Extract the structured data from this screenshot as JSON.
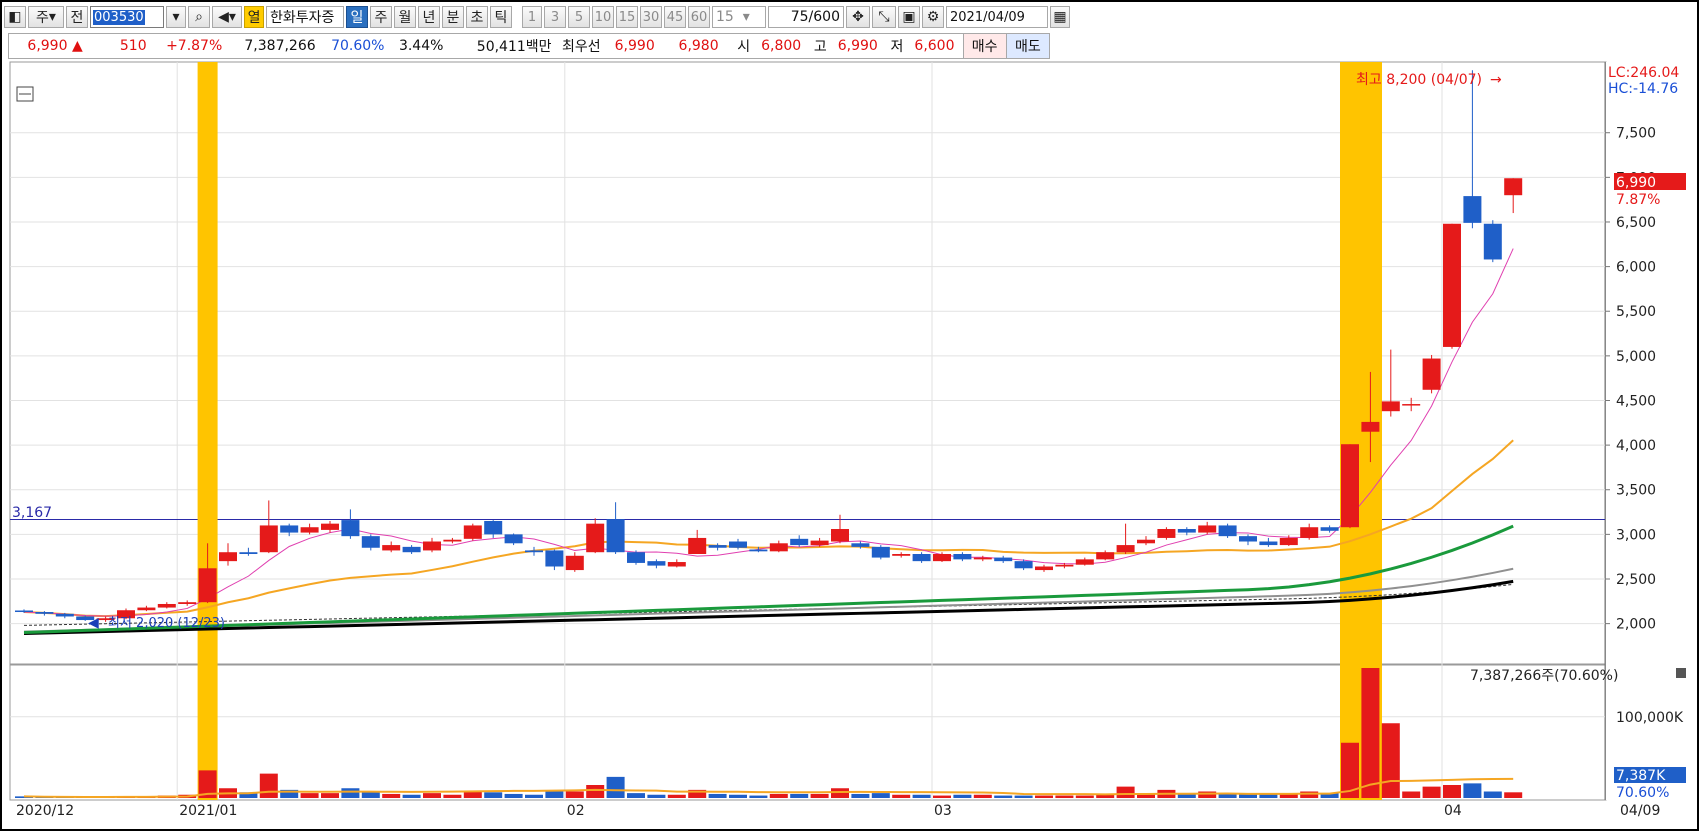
{
  "toolbar": {
    "market_label": "주",
    "prev_label": "전",
    "stock_code": "003530",
    "open_label": "열",
    "stock_name": "한화투자증",
    "periods": [
      "일",
      "주",
      "월",
      "년",
      "분",
      "초",
      "틱"
    ],
    "selected_period": "일",
    "intervals": [
      "1",
      "3",
      "5",
      "10",
      "15",
      "30",
      "45",
      "60"
    ],
    "interval_value": "15",
    "count_value": "75",
    "count_total": "/600",
    "date_value": "2021/04/09"
  },
  "quote": {
    "price": "6,990",
    "change": "510",
    "change_pct": "+7.87%",
    "volume": "7,387,266",
    "volume_ratio": "70.60%",
    "turnover": "3.44%",
    "amount": "50,411백만",
    "best_quote_label": "최우선",
    "ask": "6,990",
    "bid": "6,980",
    "open_label": "시",
    "open": "6,800",
    "high_label": "고",
    "high": "6,990",
    "low_label": "저",
    "low": "6,600",
    "buy_label": "매수",
    "sell_label": "매도"
  },
  "chart_labels": {
    "lc": "LC:246.04",
    "hc": "HC:-14.76",
    "high_marker": "최고 8,200 (04/07)",
    "low_marker": "최저 2,020 (12/23)",
    "hline_value": "3,167",
    "price_tag": "6,990",
    "pct_tag": "7.87%",
    "volume_header": "7,387,266주(70.60%)",
    "vol_tag": "7,387K",
    "vol_pct_tag": "70.60%"
  },
  "colors": {
    "up": "#e51a1a",
    "down": "#1f5fc8",
    "highlight": "#ffc400",
    "ma5": "#e040b0",
    "ma20": "#f5a623",
    "ma60": "#1a9a3c",
    "ma120": "#000000",
    "ma240": "#909090"
  },
  "chart_data": {
    "type": "candlestick",
    "x_labels": [
      "2020/12",
      "2021/01",
      "02",
      "03",
      "04",
      "04/09"
    ],
    "price_axis": [
      "7,500",
      "7,000",
      "6,500",
      "6,000",
      "5,500",
      "5,000",
      "4,500",
      "4,000",
      "3,500",
      "3,000",
      "2,500",
      "2,000"
    ],
    "ylim": [
      1570,
      8270
    ],
    "volume_axis": [
      "100,000K"
    ],
    "hline": 3167,
    "candles": [
      [
        2147,
        2130,
        2160,
        2120,
        2
      ],
      [
        2130,
        2110,
        2140,
        2090,
        1
      ],
      [
        2110,
        2080,
        2120,
        2060,
        1
      ],
      [
        2080,
        2040,
        2090,
        2030,
        1
      ],
      [
        2040,
        2060,
        2080,
        2020,
        1
      ],
      [
        2060,
        2150,
        2170,
        2050,
        2
      ],
      [
        2150,
        2180,
        2200,
        2140,
        2
      ],
      [
        2180,
        2220,
        2240,
        2170,
        3
      ],
      [
        2220,
        2240,
        2260,
        2200,
        4
      ],
      [
        2240,
        2620,
        2900,
        2230,
        34
      ],
      [
        2700,
        2800,
        2900,
        2650,
        12
      ],
      [
        2800,
        2780,
        2850,
        2760,
        7
      ],
      [
        2800,
        3100,
        3380,
        2790,
        30
      ],
      [
        3100,
        3020,
        3120,
        2980,
        10
      ],
      [
        3020,
        3080,
        3120,
        3000,
        6
      ],
      [
        3050,
        3120,
        3150,
        3020,
        6
      ],
      [
        3160,
        2980,
        3280,
        2950,
        12
      ],
      [
        2980,
        2850,
        3000,
        2820,
        7
      ],
      [
        2820,
        2880,
        2920,
        2800,
        5
      ],
      [
        2860,
        2800,
        2880,
        2780,
        4
      ],
      [
        2820,
        2920,
        2960,
        2800,
        6
      ],
      [
        2920,
        2940,
        2960,
        2900,
        4
      ],
      [
        2950,
        3100,
        3120,
        2930,
        8
      ],
      [
        3150,
        3000,
        3160,
        2960,
        7
      ],
      [
        3000,
        2900,
        3010,
        2880,
        5
      ],
      [
        2820,
        2800,
        2860,
        2760,
        4
      ],
      [
        2820,
        2640,
        2830,
        2600,
        8
      ],
      [
        2600,
        2760,
        2800,
        2580,
        8
      ],
      [
        2800,
        3120,
        3180,
        2790,
        16
      ],
      [
        3170,
        2800,
        3360,
        2780,
        26
      ],
      [
        2800,
        2680,
        2820,
        2660,
        6
      ],
      [
        2700,
        2650,
        2720,
        2620,
        4
      ],
      [
        2640,
        2690,
        2720,
        2630,
        4
      ],
      [
        2780,
        2960,
        3050,
        2780,
        10
      ],
      [
        2880,
        2850,
        2900,
        2820,
        5
      ],
      [
        2920,
        2850,
        2950,
        2830,
        4
      ],
      [
        2830,
        2810,
        2860,
        2800,
        3
      ],
      [
        2810,
        2900,
        2930,
        2800,
        5
      ],
      [
        2950,
        2880,
        2990,
        2860,
        5
      ],
      [
        2880,
        2930,
        2960,
        2860,
        5
      ],
      [
        2920,
        3060,
        3220,
        2900,
        12
      ],
      [
        2900,
        2860,
        2920,
        2840,
        5
      ],
      [
        2860,
        2740,
        2880,
        2720,
        6
      ],
      [
        2760,
        2780,
        2800,
        2740,
        4
      ],
      [
        2780,
        2700,
        2800,
        2680,
        4
      ],
      [
        2700,
        2780,
        2800,
        2690,
        3
      ],
      [
        2780,
        2720,
        2800,
        2700,
        4
      ],
      [
        2720,
        2740,
        2760,
        2700,
        4
      ],
      [
        2740,
        2700,
        2760,
        2680,
        3
      ],
      [
        2700,
        2620,
        2720,
        2600,
        3
      ],
      [
        2600,
        2640,
        2660,
        2580,
        3
      ],
      [
        2640,
        2660,
        2680,
        2620,
        3
      ],
      [
        2660,
        2720,
        2740,
        2650,
        3
      ],
      [
        2720,
        2800,
        2820,
        2710,
        4
      ],
      [
        2800,
        2880,
        3120,
        2780,
        14
      ],
      [
        2900,
        2940,
        2980,
        2880,
        5
      ],
      [
        2960,
        3060,
        3080,
        2940,
        10
      ],
      [
        3060,
        3020,
        3080,
        2990,
        6
      ],
      [
        3020,
        3100,
        3140,
        3000,
        8
      ],
      [
        3100,
        2980,
        3120,
        2960,
        6
      ],
      [
        2980,
        2920,
        3000,
        2880,
        5
      ],
      [
        2920,
        2880,
        2960,
        2860,
        5
      ],
      [
        2880,
        2960,
        2990,
        2870,
        6
      ],
      [
        2960,
        3080,
        3120,
        2940,
        8
      ],
      [
        3080,
        3040,
        3100,
        3020,
        6
      ],
      [
        3080,
        4010,
        4010,
        3070,
        68
      ],
      [
        4150,
        4260,
        4820,
        3810,
        160
      ],
      [
        4380,
        4490,
        5070,
        4320,
        92
      ],
      [
        4450,
        4460,
        4530,
        4380,
        8
      ],
      [
        4620,
        4970,
        5010,
        4580,
        14
      ],
      [
        5100,
        6480,
        6480,
        5080,
        16
      ],
      [
        6790,
        6490,
        8200,
        6430,
        18
      ],
      [
        6480,
        6080,
        6520,
        6050,
        8
      ],
      [
        6800,
        6990,
        6990,
        6600,
        7
      ]
    ],
    "ma5_tail": [
      2500,
      2700,
      2900,
      3100,
      3500,
      4100,
      4600,
      5200,
      5800,
      6280
    ],
    "note": "candles rows are [open, close, high, low, volume_in_100K_units]"
  }
}
